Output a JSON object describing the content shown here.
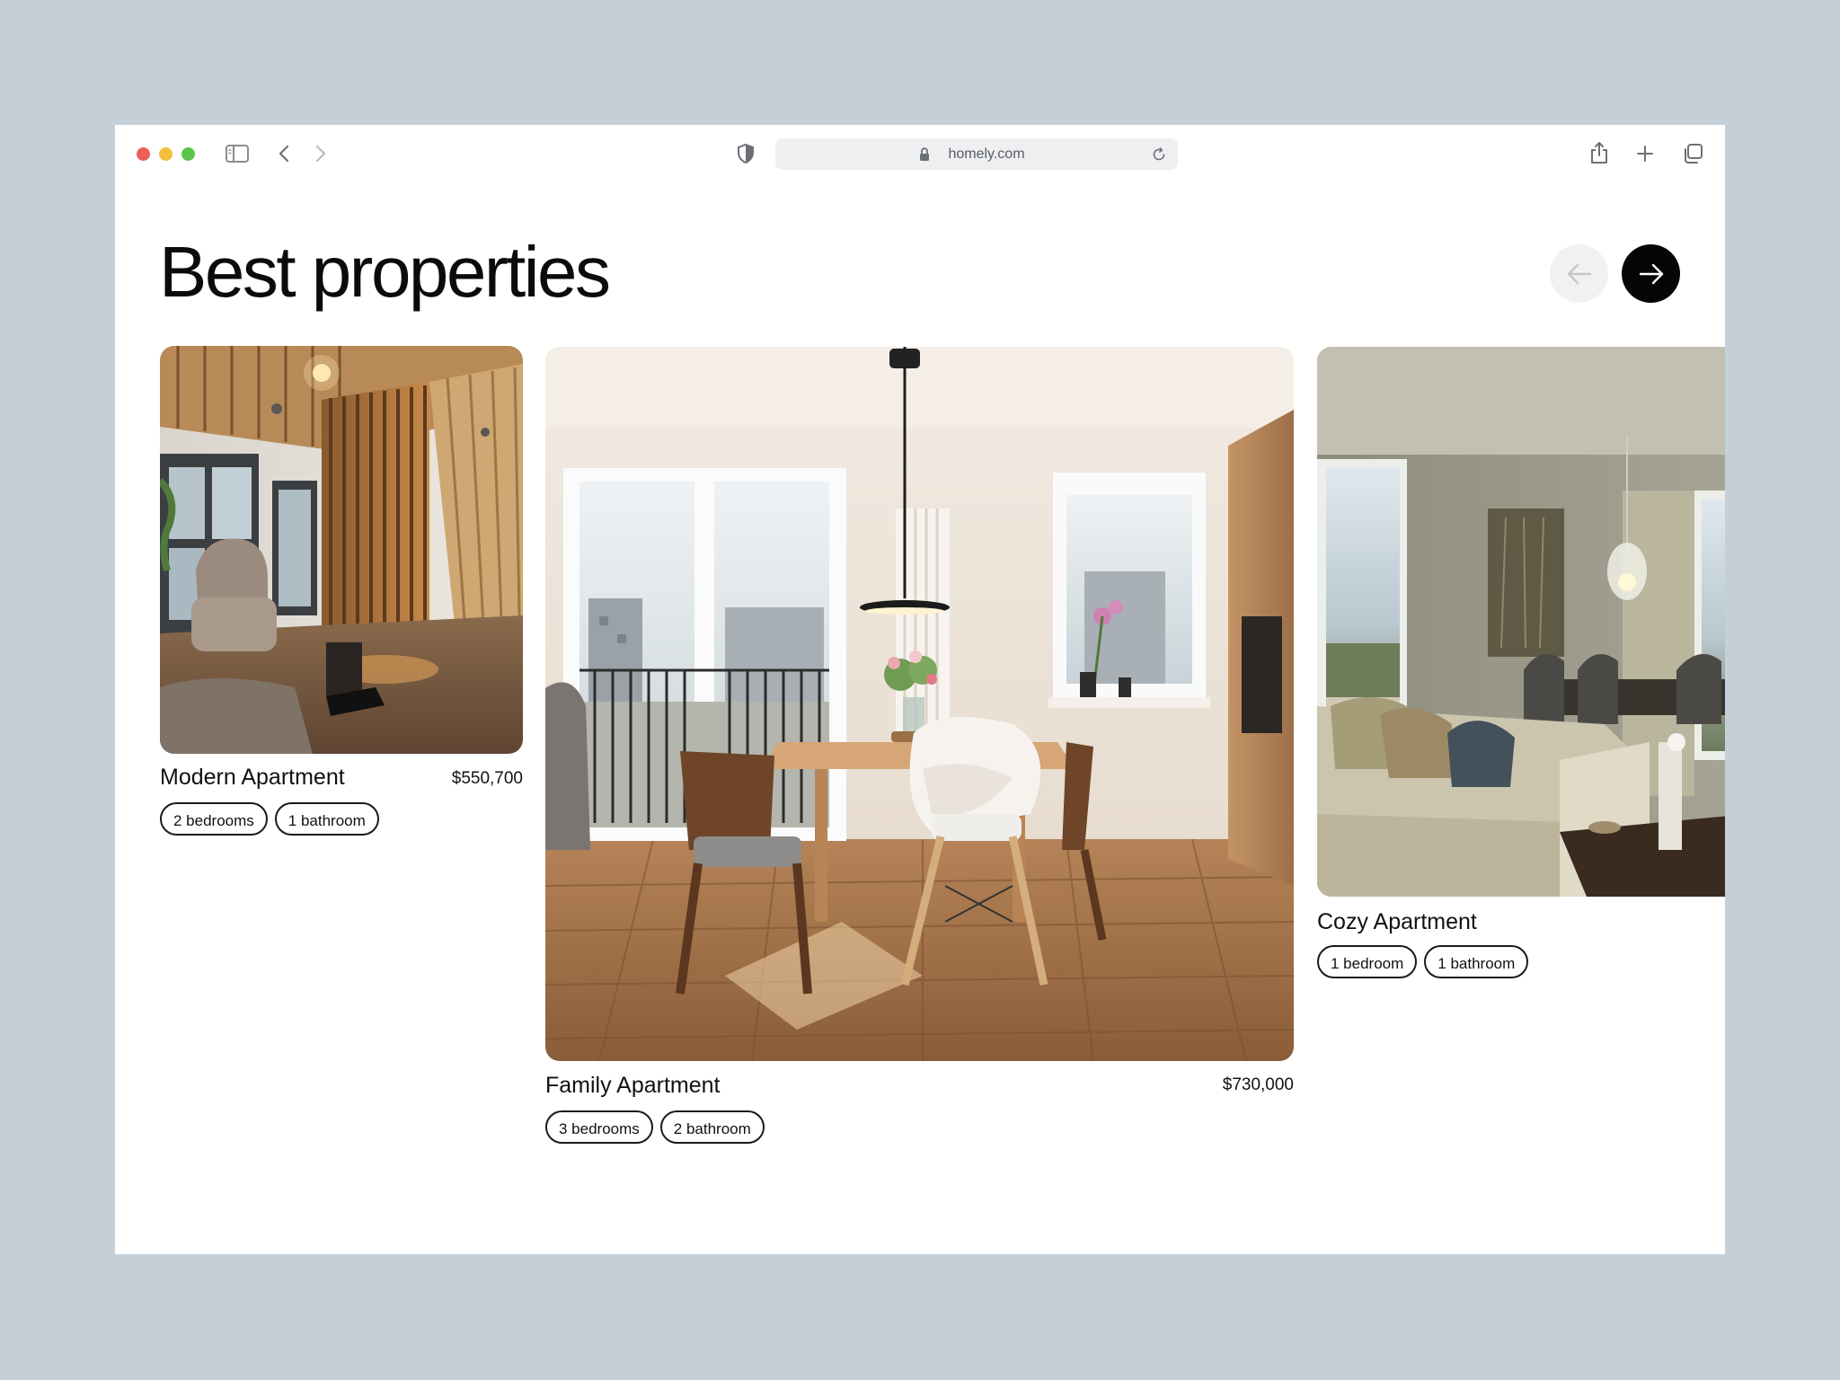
{
  "browser": {
    "url": "homely.com",
    "icons": [
      "sidebar-icon",
      "chevron-left-icon",
      "chevron-right-icon",
      "shield-icon",
      "lock-icon",
      "reload-icon",
      "share-icon",
      "plus-icon",
      "tabs-icon"
    ]
  },
  "section": {
    "title": "Best properties",
    "prev_icon": "arrow-left-icon",
    "next_icon": "arrow-right-icon"
  },
  "properties": [
    {
      "name": "Modern Apartment",
      "price": "$550,700",
      "tags": [
        "2 bedrooms",
        "1 bathroom"
      ]
    },
    {
      "name": "Family Apartment",
      "price": "$730,000",
      "tags": [
        "3 bedrooms",
        "2 bathroom"
      ]
    },
    {
      "name": "Cozy Apartment",
      "price": "",
      "tags": [
        "1 bedroom",
        "1 bathroom"
      ]
    }
  ],
  "colors": {
    "backdrop": "#c5cfd8",
    "window": "#ffffff",
    "accent": "#050505",
    "close": "#ec5f56",
    "minimize": "#f4bd3a",
    "zoom": "#5bc54c"
  }
}
